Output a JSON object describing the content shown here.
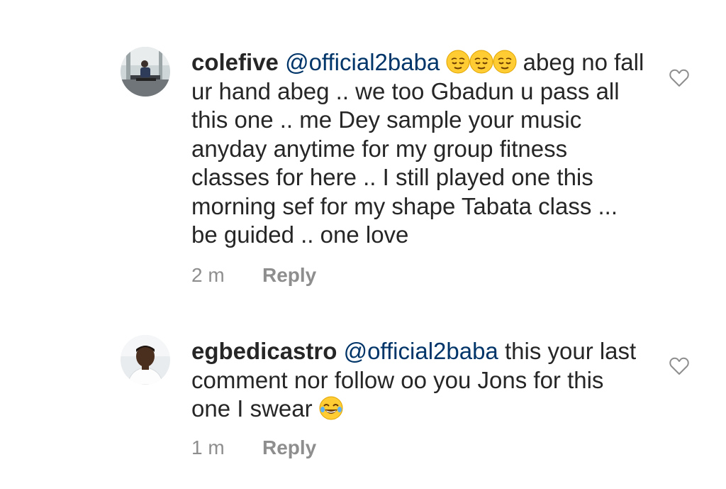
{
  "comments": [
    {
      "username": "colefive",
      "mention": "@official2baba",
      "text_after_emoji": " abeg no fall ur hand abeg .. we too Gbadun u pass all this one .. me Dey sample your music anyday anytime for my group fitness classes for here .. I still played one this morning sef for my shape Tabata class ... be guided .. one love",
      "emoji": [
        "relieved-face-emoji",
        "relieved-face-emoji",
        "relieved-face-emoji"
      ],
      "time": "2 m",
      "reply_label": "Reply",
      "avatar_icon": "avatar-photo"
    },
    {
      "username": "egbedicastro",
      "mention": "@official2baba",
      "text": " this your last comment nor follow oo you Jons for this one I swear ",
      "emoji": [
        "tears-of-joy-emoji"
      ],
      "time": "1 m",
      "reply_label": "Reply",
      "avatar_icon": "avatar-photo"
    }
  ],
  "colors": {
    "text": "#262626",
    "mention": "#003569",
    "meta": "#8e8e8e",
    "emoji_yellow": "#ffcc33"
  },
  "icons": {
    "like": "heart-outline-icon"
  }
}
